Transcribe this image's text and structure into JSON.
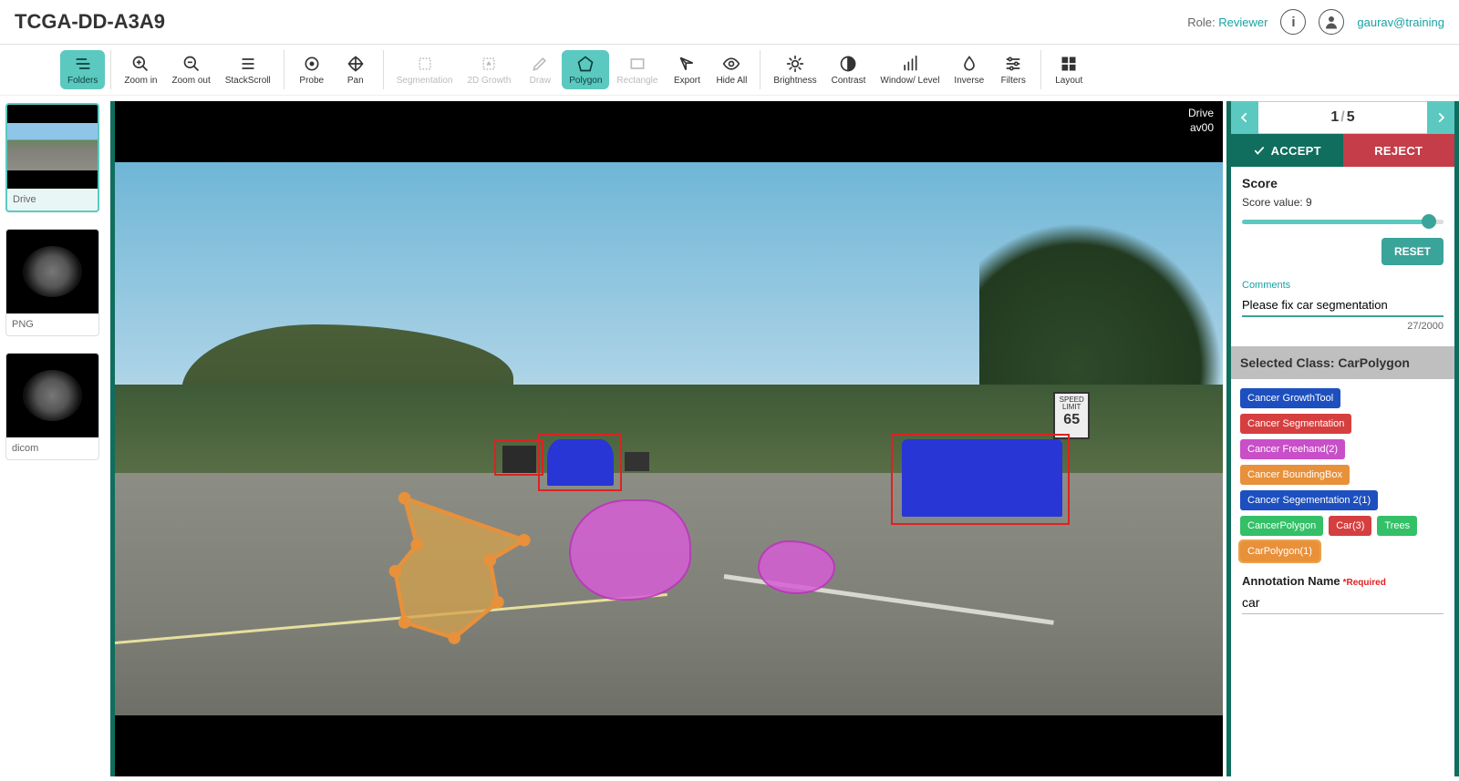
{
  "header": {
    "title": "TCGA-DD-A3A9",
    "role_label": "Role:",
    "role_value": "Reviewer",
    "user": "gaurav@training"
  },
  "toolbar": [
    {
      "id": "folders",
      "label": "Folders",
      "active": true,
      "disabled": false
    },
    {
      "id": "zoomin",
      "label": "Zoom in",
      "active": false,
      "disabled": false
    },
    {
      "id": "zoomout",
      "label": "Zoom out",
      "active": false,
      "disabled": false
    },
    {
      "id": "stackscroll",
      "label": "StackScroll",
      "active": false,
      "disabled": false
    },
    {
      "id": "probe",
      "label": "Probe",
      "active": false,
      "disabled": false
    },
    {
      "id": "pan",
      "label": "Pan",
      "active": false,
      "disabled": false
    },
    {
      "id": "segmentation",
      "label": "Segmentation",
      "active": false,
      "disabled": true
    },
    {
      "id": "growth",
      "label": "2D Growth",
      "active": false,
      "disabled": true
    },
    {
      "id": "draw",
      "label": "Draw",
      "active": false,
      "disabled": true
    },
    {
      "id": "polygon",
      "label": "Polygon",
      "active": true,
      "disabled": false
    },
    {
      "id": "rectangle",
      "label": "Rectangle",
      "active": false,
      "disabled": true
    },
    {
      "id": "export",
      "label": "Export",
      "active": false,
      "disabled": false
    },
    {
      "id": "hideall",
      "label": "Hide All",
      "active": false,
      "disabled": false
    },
    {
      "id": "brightness",
      "label": "Brightness",
      "active": false,
      "disabled": false
    },
    {
      "id": "contrast",
      "label": "Contrast",
      "active": false,
      "disabled": false
    },
    {
      "id": "windowlevel",
      "label": "Window/ Level",
      "active": false,
      "disabled": false
    },
    {
      "id": "inverse",
      "label": "Inverse",
      "active": false,
      "disabled": false
    },
    {
      "id": "filters",
      "label": "Filters",
      "active": false,
      "disabled": false
    },
    {
      "id": "layout",
      "label": "Layout",
      "active": false,
      "disabled": false
    }
  ],
  "thumbs": [
    {
      "label": "Drive",
      "kind": "road",
      "selected": true
    },
    {
      "label": "PNG",
      "kind": "ct",
      "selected": false
    },
    {
      "label": "dicom",
      "kind": "ct",
      "selected": false
    }
  ],
  "canvas": {
    "overlay_line1": "Drive",
    "overlay_line2": "av00",
    "speed_sign": {
      "line1": "SPEED",
      "line2": "LIMIT",
      "num": "65"
    }
  },
  "pager": {
    "current": "1",
    "total": "5"
  },
  "actions": {
    "accept": "ACCEPT",
    "reject": "REJECT"
  },
  "score": {
    "title": "Score",
    "value_label": "Score value: 9",
    "value": 9,
    "max": 10,
    "reset": "RESET"
  },
  "comments": {
    "label": "Comments",
    "value": "Please fix car segmentation",
    "counter": "27/2000"
  },
  "selected_class": {
    "prefix": "Selected Class: ",
    "name": "CarPolygon"
  },
  "tags": [
    {
      "label": "Cancer GrowthTool",
      "color": "#1d4fbf"
    },
    {
      "label": "Cancer Segmentation",
      "color": "#d63f3f"
    },
    {
      "label": "Cancer Freehand(2)",
      "color": "#c84fc8"
    },
    {
      "label": "Cancer BoundingBox",
      "color": "#e8913a"
    },
    {
      "label": "Cancer Segementation 2(1)",
      "color": "#1d4fbf"
    },
    {
      "label": "CancerPolygon",
      "color": "#34c067"
    },
    {
      "label": "Car(3)",
      "color": "#d63f3f"
    },
    {
      "label": "Trees",
      "color": "#34c067"
    },
    {
      "label": "CarPolygon(1)",
      "color": "#e8913a",
      "selected": true
    }
  ],
  "annotation": {
    "label": "Annotation Name",
    "required": "*Required",
    "value": "car"
  }
}
